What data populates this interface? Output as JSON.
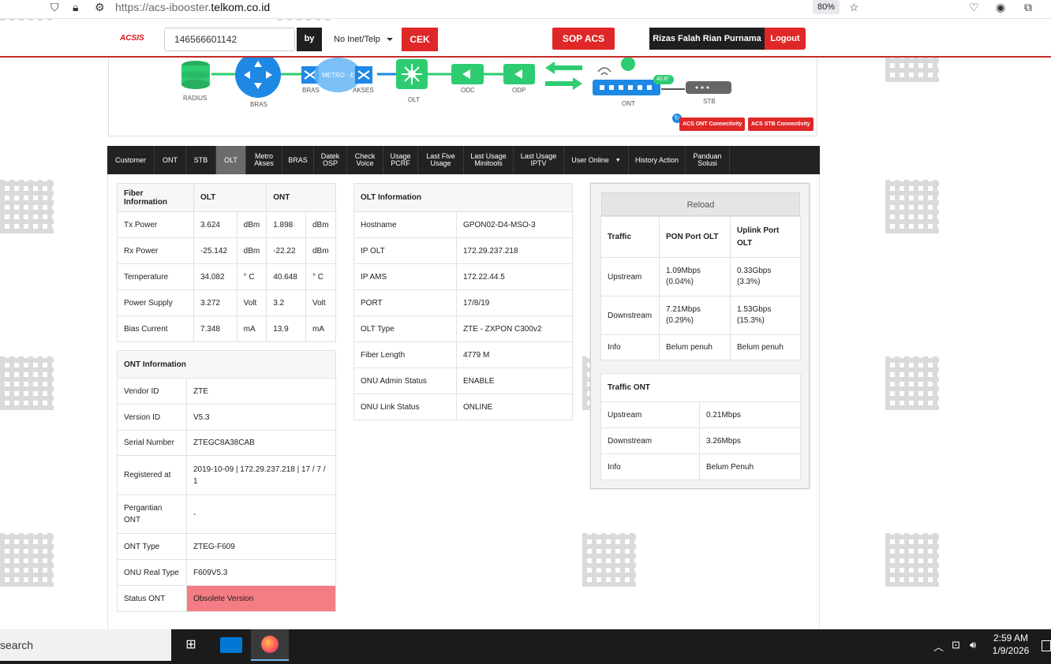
{
  "browser": {
    "url_prefix": "https://acs-ibooster.",
    "url_domain": "telkom.co.id",
    "zoom": "80%"
  },
  "header": {
    "logo": "ACSIS",
    "search_value": "146566601142",
    "by_label": "by",
    "select_value": "No Inet/Telp",
    "cek_label": "CEK",
    "sop_label": "SOP ACS",
    "user_name": "Rizas Falah Rian Purnama",
    "logout_label": "Logout"
  },
  "topology": {
    "radius": "RADIUS",
    "bras1": "BRAS",
    "bras2": "BRAS",
    "metro": "METRO - E",
    "akses": "AKSES",
    "olt": "OLT",
    "odc": "ODC",
    "odp": "ODP",
    "ont": "ONT",
    "stb": "STB",
    "ont_badge": "40.8°",
    "acs_ont": "ACS ONT Connectivity",
    "acs_stb": "ACS STB Connectivity"
  },
  "tabs": [
    {
      "l1": "Customer",
      "l2": ""
    },
    {
      "l1": "ONT",
      "l2": ""
    },
    {
      "l1": "STB",
      "l2": ""
    },
    {
      "l1": "OLT",
      "l2": ""
    },
    {
      "l1": "Metro",
      "l2": "Akses"
    },
    {
      "l1": "BRAS",
      "l2": ""
    },
    {
      "l1": "Datek",
      "l2": "OSP"
    },
    {
      "l1": "Check",
      "l2": "Voice"
    },
    {
      "l1": "Usage",
      "l2": "PCRF"
    },
    {
      "l1": "Last Five",
      "l2": "Usage"
    },
    {
      "l1": "Last Usage",
      "l2": "Minitools"
    },
    {
      "l1": "Last Usage",
      "l2": "IPTV"
    },
    {
      "l1": "User Online",
      "l2": ""
    },
    {
      "l1": "History Action",
      "l2": ""
    },
    {
      "l1": "Panduan",
      "l2": "Solusi"
    }
  ],
  "fiber": {
    "headers": [
      "Fiber Information",
      "OLT",
      "ONT"
    ],
    "rows": [
      [
        "Tx Power",
        "3.624",
        "dBm",
        "1.898",
        "dBm"
      ],
      [
        "Rx Power",
        "-25.142",
        "dBm",
        "-22.22",
        "dBm"
      ],
      [
        "Temperature",
        "34.082",
        "° C",
        "40.648",
        "° C"
      ],
      [
        "Power Supply",
        "3.272",
        "Volt",
        "3.2",
        "Volt"
      ],
      [
        "Bias Current",
        "7.348",
        "mA",
        "13.9",
        "mA"
      ]
    ]
  },
  "ont_info": {
    "title": "ONT Information",
    "rows": [
      [
        "Vendor ID",
        "ZTE"
      ],
      [
        "Version ID",
        "V5.3"
      ],
      [
        "Serial Number",
        "ZTEGC8A38CAB"
      ],
      [
        "Registered at",
        "2019-10-09 | 172.29.237.218 | 17 / 7 / 1"
      ],
      [
        "Pergantian ONT",
        "-"
      ],
      [
        "ONT Type",
        "ZTEG-F609"
      ],
      [
        "ONU Real Type",
        "F609V5.3"
      ],
      [
        "Status ONT",
        "Obsolete Version"
      ]
    ]
  },
  "olt_info": {
    "title": "OLT Information",
    "rows": [
      [
        "Hostname",
        "GPON02-D4-MSO-3"
      ],
      [
        "IP OLT",
        "172.29.237.218"
      ],
      [
        "IP AMS",
        "172.22.44.5"
      ],
      [
        "PORT",
        "17/8/19"
      ],
      [
        "OLT Type",
        "ZTE - ZXPON C300v2"
      ],
      [
        "Fiber Length",
        "4779 M"
      ],
      [
        "ONU Admin Status",
        "ENABLE"
      ],
      [
        "ONU Link Status",
        "ONLINE"
      ]
    ]
  },
  "traffic": {
    "reload": "Reload",
    "headers": [
      "Traffic",
      "PON Port OLT",
      "Uplink Port OLT"
    ],
    "rows": [
      [
        "Upstream",
        "1.09Mbps (0.04%)",
        "0.33Gbps (3.3%)"
      ],
      [
        "Downstream",
        "7.21Mbps (0.29%)",
        "1.53Gbps (15.3%)"
      ],
      [
        "Info",
        "Belum penuh",
        "Belum penuh"
      ]
    ]
  },
  "traffic_ont": {
    "title": "Traffic ONT",
    "rows": [
      [
        "Upstream",
        "0.21Mbps"
      ],
      [
        "Downstream",
        "3.26Mbps"
      ],
      [
        "Info",
        "Belum Penuh"
      ]
    ]
  },
  "taskbar": {
    "search": "search",
    "time": "2:59 AM",
    "date": "1/9/2026"
  },
  "colors": {
    "accent_red": "#e02727",
    "dark": "#222222",
    "green": "#2ecc71",
    "blue": "#1e88e5",
    "status_bad": "#f47c84"
  }
}
